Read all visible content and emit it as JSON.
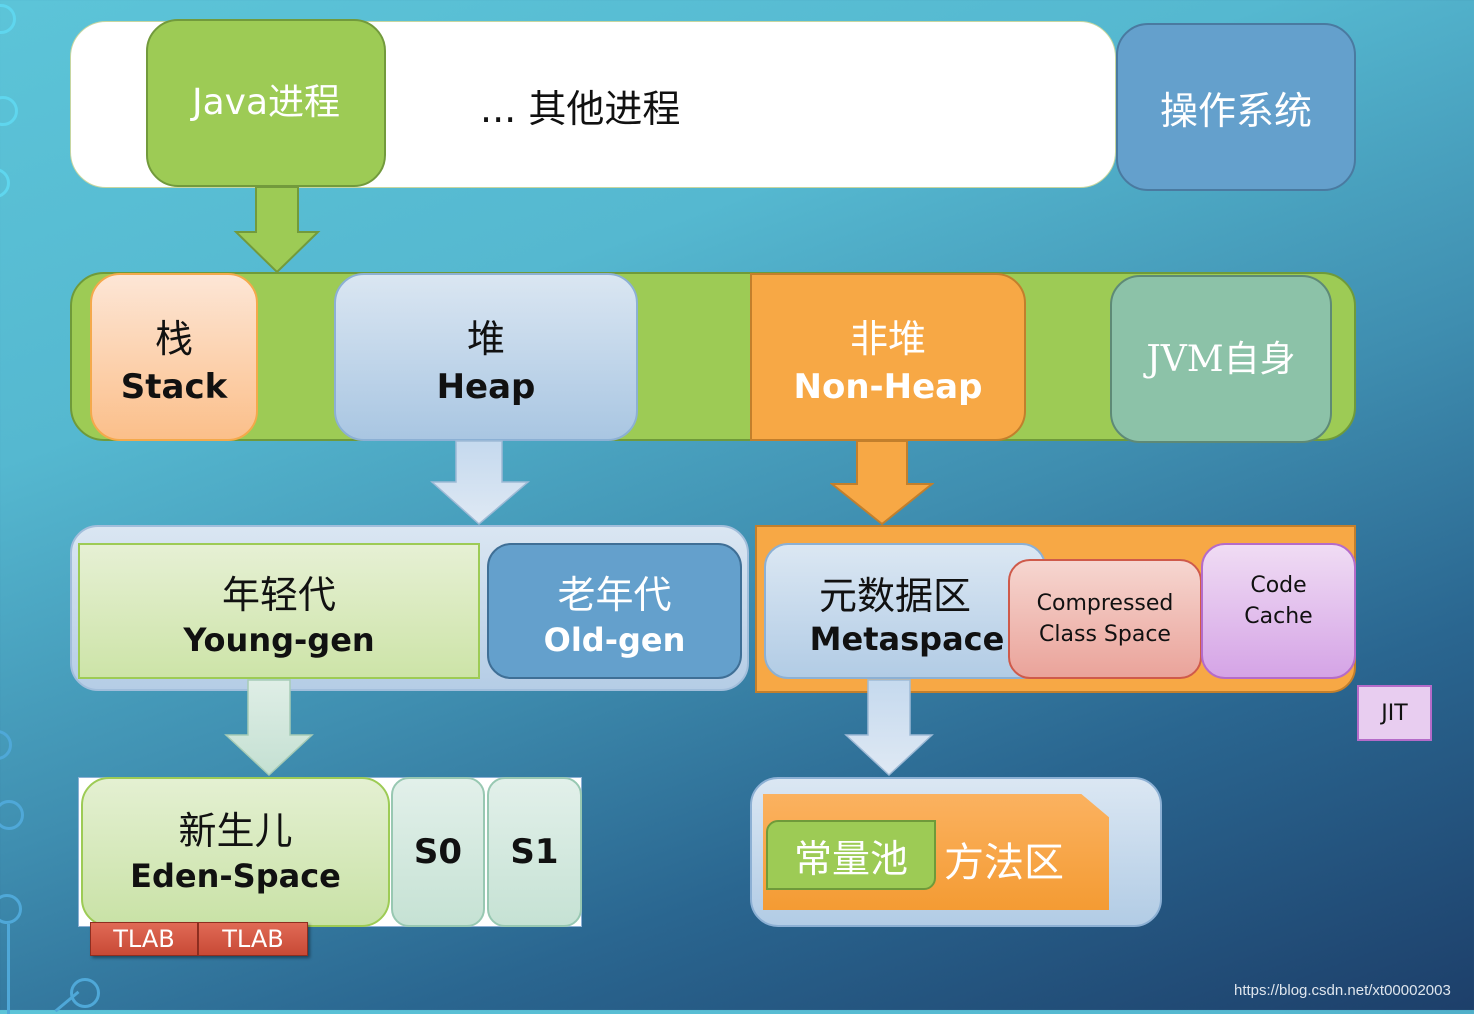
{
  "process_row": {
    "java_process": "Java进程",
    "other_processes": "... 其他进程",
    "os": "操作系统"
  },
  "jvm_row": {
    "stack_cn": "栈",
    "stack_en": "Stack",
    "heap_cn": "堆",
    "heap_en": "Heap",
    "nonheap_cn": "非堆",
    "nonheap_en": "Non-Heap",
    "jvm_self": "JVM自身"
  },
  "heap_row": {
    "young_cn": "年轻代",
    "young_en": "Young-gen",
    "old_cn": "老年代",
    "old_en": "Old-gen"
  },
  "nonheap_row": {
    "meta_cn": "元数据区",
    "meta_en": "Metaspace",
    "ccs_line1": "Compressed",
    "ccs_line2": "Class Space",
    "code_line1": "Code",
    "code_line2": "Cache",
    "jit": "JIT"
  },
  "young_row": {
    "eden_cn": "新生儿",
    "eden_en": "Eden-Space",
    "s0": "S0",
    "s1": "S1",
    "tlab1": "TLAB",
    "tlab2": "TLAB"
  },
  "method_area": {
    "constant_pool": "常量池",
    "method_area": "方法区"
  },
  "watermark": "https://blog.csdn.net/xt00002003",
  "colors": {
    "green": "#9dcb55",
    "blue": "#64a0cc",
    "orange": "#f7a845",
    "light_blue": "#c9dcee",
    "teal": "#8cc2a8",
    "pink": "#eeaaa2",
    "purple": "#dcb0ea",
    "tlab_red": "#d15540"
  }
}
